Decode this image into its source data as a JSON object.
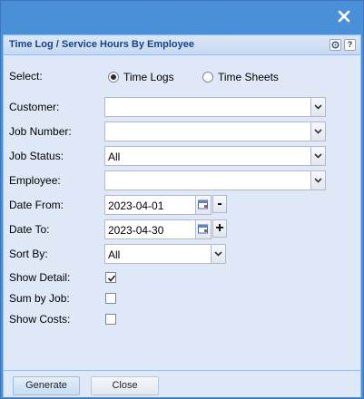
{
  "window": {
    "close_icon": "close-icon",
    "panel_title": "Time Log / Service Hours By Employee",
    "header_tools": {
      "gear_icon": "gear-icon",
      "help_label": "?"
    }
  },
  "form": {
    "select_label": "Select:",
    "radio_time_logs": "Time Logs",
    "radio_time_sheets": "Time Sheets",
    "selected_radio": "Time Logs",
    "customer_label": "Customer:",
    "customer_value": "",
    "job_number_label": "Job Number:",
    "job_number_value": "",
    "job_status_label": "Job Status:",
    "job_status_value": "All",
    "employee_label": "Employee:",
    "employee_value": "",
    "date_from_label": "Date From:",
    "date_from_value": "2023-04-01",
    "date_from_step": "-",
    "date_to_label": "Date To:",
    "date_to_value": "2023-04-30",
    "date_to_step": "+",
    "sort_by_label": "Sort By:",
    "sort_by_value": "All",
    "show_detail_label": "Show Detail:",
    "show_detail_checked": true,
    "sum_by_job_label": "Sum by Job:",
    "sum_by_job_checked": false,
    "show_costs_label": "Show Costs:",
    "show_costs_checked": false
  },
  "footer": {
    "generate_label": "Generate",
    "close_label": "Close"
  }
}
